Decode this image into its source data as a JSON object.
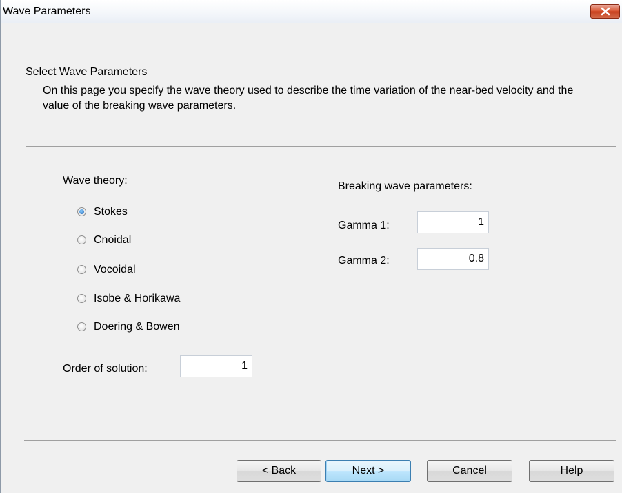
{
  "window": {
    "title": "Wave Parameters"
  },
  "header": {
    "title": "Select Wave Parameters",
    "description": "On this page you specify the wave theory used to describe the time variation of the near-bed velocity and the value of the breaking wave parameters."
  },
  "wave_theory": {
    "label": "Wave theory:",
    "options": [
      {
        "label": "Stokes",
        "selected": true
      },
      {
        "label": "Cnoidal",
        "selected": false
      },
      {
        "label": "Vocoidal",
        "selected": false
      },
      {
        "label": "Isobe & Horikawa",
        "selected": false
      },
      {
        "label": "Doering & Bowen",
        "selected": false
      }
    ]
  },
  "order_of_solution": {
    "label": "Order of solution:",
    "value": "1"
  },
  "breaking": {
    "label": "Breaking wave parameters:",
    "gamma1": {
      "label": "Gamma 1:",
      "value": "1"
    },
    "gamma2": {
      "label": "Gamma 2:",
      "value": "0.8"
    }
  },
  "buttons": {
    "back": "< Back",
    "next": "Next >",
    "cancel": "Cancel",
    "help": "Help"
  },
  "icons": {
    "close": "close-icon",
    "radio": "radio-button-icon"
  },
  "colors": {
    "close_button": "#c7401e",
    "default_button_border": "#3c7fb1",
    "radio_selected": "#1a5fb4"
  }
}
